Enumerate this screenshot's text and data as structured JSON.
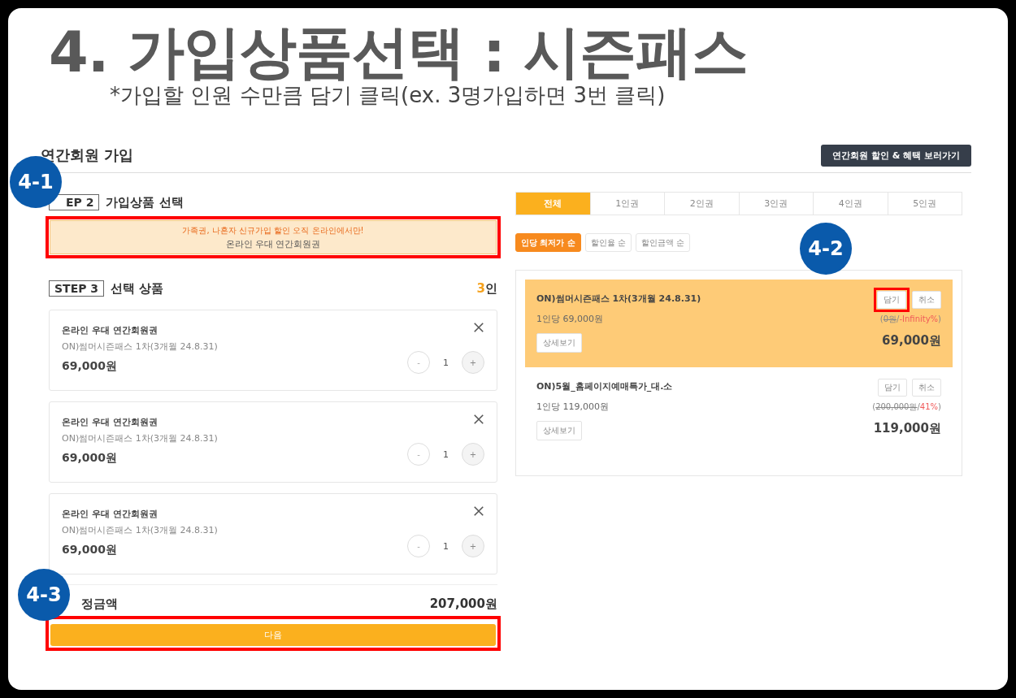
{
  "slide": {
    "title": "4. 가입상품선택 : 시즌패스",
    "subtitle": "*가입할 인원 수만큼 담기 클릭(ex. 3명가입하면 3번 클릭)"
  },
  "page": {
    "heading": "연간회원 가입",
    "benefits_button": "연간회원 할인 & 혜택 보러가기"
  },
  "step2": {
    "badge": "EP 2",
    "title": "가입상품 선택",
    "notice": "가족권, 나혼자 신규가입 할인 오직 온라인에서만!",
    "product": "온라인 우대 연간회원권"
  },
  "step3": {
    "badge": "STEP 3",
    "title": "선택 상품",
    "count": "3",
    "count_unit": "인"
  },
  "cart_items": [
    {
      "category": "온라인 우대 연간회원권",
      "product": "ON)썸머시즌패스 1차(3개월 24.8.31)",
      "price": "69,000원",
      "minus": "-",
      "quantity": "1",
      "plus": "+"
    },
    {
      "category": "온라인 우대 연간회원권",
      "product": "ON)썸머시즌패스 1차(3개월 24.8.31)",
      "price": "69,000원",
      "minus": "-",
      "quantity": "1",
      "plus": "+"
    },
    {
      "category": "온라인 우대 연간회원권",
      "product": "ON)썸머시즌패스 1차(3개월 24.8.31)",
      "price": "69,000원",
      "minus": "-",
      "quantity": "1",
      "plus": "+"
    }
  ],
  "total": {
    "label": "정금액",
    "amount": "207,000원"
  },
  "next_button": "다음",
  "tabs": [
    {
      "label": "전체",
      "selected": true
    },
    {
      "label": "1인권",
      "selected": false
    },
    {
      "label": "2인권",
      "selected": false
    },
    {
      "label": "3인권",
      "selected": false
    },
    {
      "label": "4인권",
      "selected": false
    },
    {
      "label": "5인권",
      "selected": false
    }
  ],
  "sorts": [
    {
      "label": "인당 최저가 순",
      "selected": true
    },
    {
      "label": "할인율 순",
      "selected": false
    },
    {
      "label": "할인금액 순",
      "selected": false
    }
  ],
  "products": [
    {
      "name": "ON)썸머시즌패스 1차(3개월 24.8.31)",
      "unit_price": "1인당 69,000원",
      "add": "담기",
      "cancel": "취소",
      "comparison": [
        {
          "text": "(",
          "kind": "plain"
        },
        {
          "text": "0원",
          "kind": "struck"
        },
        {
          "text": "/",
          "kind": "plain"
        },
        {
          "text": "-Infinity%",
          "kind": "discount"
        },
        {
          "text": ")",
          "kind": "plain"
        }
      ],
      "details": "상세보기",
      "price": "69,000원",
      "selected": true
    },
    {
      "name": "ON)5월_홈페이지예매특가_대.소",
      "unit_price": "1인당 119,000원",
      "add": "담기",
      "cancel": "취소",
      "comparison": [
        {
          "text": "(",
          "kind": "plain"
        },
        {
          "text": "200,000원",
          "kind": "struck"
        },
        {
          "text": "/",
          "kind": "plain"
        },
        {
          "text": "41%",
          "kind": "discount"
        },
        {
          "text": ")",
          "kind": "plain"
        }
      ],
      "details": "상세보기",
      "price": "119,000원",
      "selected": false
    }
  ],
  "markers": [
    {
      "label": "4-1"
    },
    {
      "label": "4-2"
    },
    {
      "label": "4-3"
    }
  ]
}
